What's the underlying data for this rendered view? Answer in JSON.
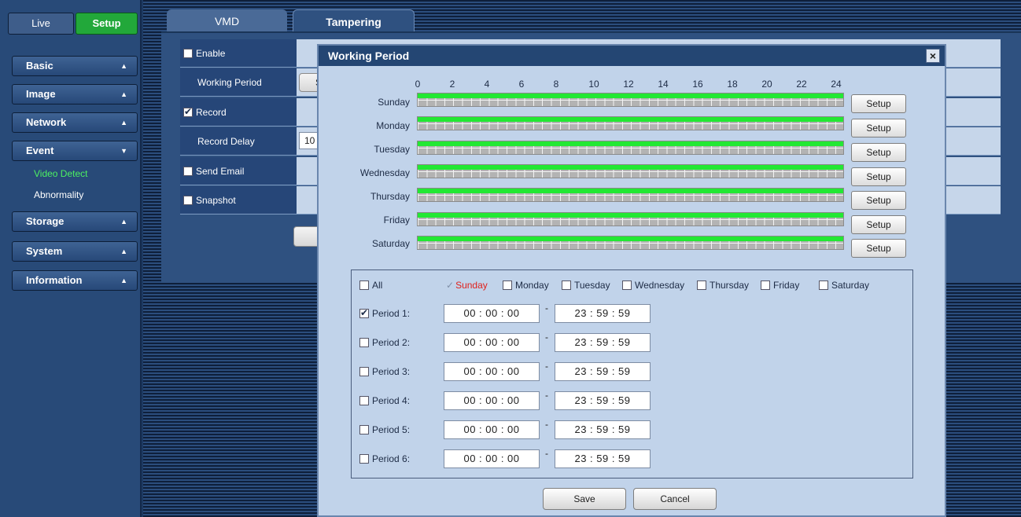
{
  "nav": {
    "live": "Live",
    "setup": "Setup"
  },
  "menu": [
    {
      "label": "Basic",
      "arrow": "▲"
    },
    {
      "label": "Image",
      "arrow": "▲"
    },
    {
      "label": "Network",
      "arrow": "▲"
    },
    {
      "label": "Event",
      "arrow": "▼"
    },
    {
      "label": "Storage",
      "arrow": "▲"
    },
    {
      "label": "System",
      "arrow": "▲"
    },
    {
      "label": "Information",
      "arrow": "▲"
    }
  ],
  "submenu": {
    "video_detect": "Video Detect",
    "abnormality": "Abnormality"
  },
  "tabs": {
    "vmd": "VMD",
    "tampering": "Tampering"
  },
  "form": {
    "enable": "Enable",
    "working_period": "Working Period",
    "working_period_btn_partial": "S",
    "record": "Record",
    "record_delay": "Record Delay",
    "record_delay_value": "10",
    "send_email": "Send Email",
    "snapshot": "Snapshot"
  },
  "dialog": {
    "title": "Working Period",
    "close": "×",
    "hours": [
      "0",
      "2",
      "4",
      "6",
      "8",
      "10",
      "12",
      "14",
      "16",
      "18",
      "20",
      "22",
      "24"
    ],
    "days": [
      "Sunday",
      "Monday",
      "Tuesday",
      "Wednesday",
      "Thursday",
      "Friday",
      "Saturday"
    ],
    "setup_label": "Setup",
    "all_label": "All",
    "day_options": [
      "Sunday",
      "Monday",
      "Tuesday",
      "Wednesday",
      "Thursday",
      "Friday",
      "Saturday"
    ],
    "periods": [
      {
        "label": "Period 1:",
        "checked": true,
        "start": "00 : 00 : 00",
        "end": "23 : 59 : 59"
      },
      {
        "label": "Period 2:",
        "checked": false,
        "start": "00 : 00 : 00",
        "end": "23 : 59 : 59"
      },
      {
        "label": "Period 3:",
        "checked": false,
        "start": "00 : 00 : 00",
        "end": "23 : 59 : 59"
      },
      {
        "label": "Period 4:",
        "checked": false,
        "start": "00 : 00 : 00",
        "end": "23 : 59 : 59"
      },
      {
        "label": "Period 5:",
        "checked": false,
        "start": "00 : 00 : 00",
        "end": "23 : 59 : 59"
      },
      {
        "label": "Period 6:",
        "checked": false,
        "start": "00 : 00 : 00",
        "end": "23 : 59 : 59"
      }
    ],
    "dash": "-",
    "save": "Save",
    "cancel": "Cancel"
  }
}
